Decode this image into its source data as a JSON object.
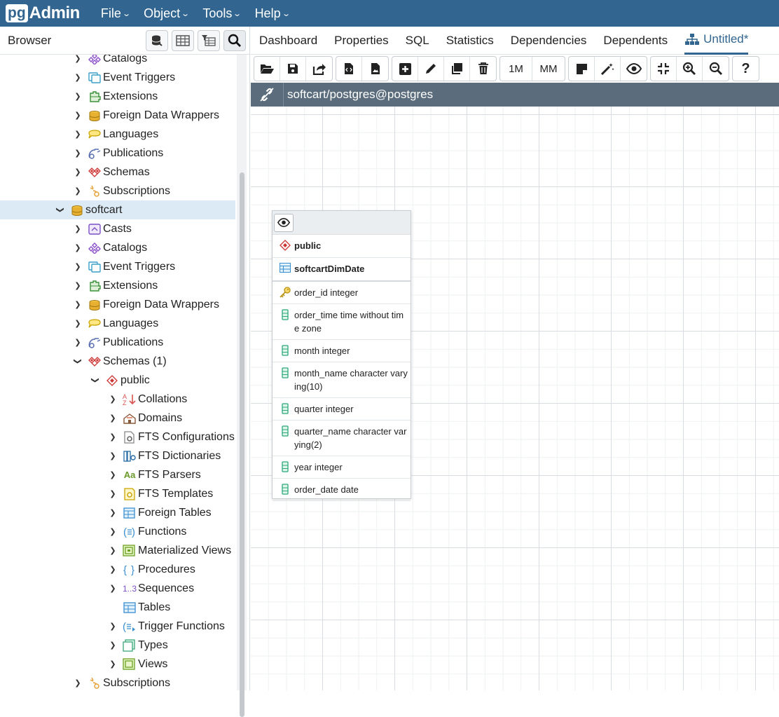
{
  "app": {
    "logo_pg": "pg",
    "logo_admin": "Admin"
  },
  "menu": [
    {
      "label": "File"
    },
    {
      "label": "Object"
    },
    {
      "label": "Tools"
    },
    {
      "label": "Help"
    }
  ],
  "browser": {
    "title": "Browser",
    "tree": [
      {
        "label": "Catalogs",
        "icon": "catalog-icon",
        "chevron": "right"
      },
      {
        "label": "Event Triggers",
        "icon": "event-trigger-icon",
        "chevron": "right"
      },
      {
        "label": "Extensions",
        "icon": "extension-icon",
        "chevron": "right"
      },
      {
        "label": "Foreign Data Wrappers",
        "icon": "fdw-icon",
        "chevron": "right"
      },
      {
        "label": "Languages",
        "icon": "language-icon",
        "chevron": "right"
      },
      {
        "label": "Publications",
        "icon": "publication-icon",
        "chevron": "right"
      },
      {
        "label": "Schemas",
        "icon": "schemas-icon",
        "chevron": "right"
      },
      {
        "label": "Subscriptions",
        "icon": "subscription-icon",
        "chevron": "right"
      },
      {
        "label": "softcart",
        "icon": "database-icon",
        "chevron": "down",
        "selected": true
      },
      {
        "label": "Casts",
        "icon": "cast-icon",
        "chevron": "right"
      },
      {
        "label": "Catalogs",
        "icon": "catalog-icon",
        "chevron": "right"
      },
      {
        "label": "Event Triggers",
        "icon": "event-trigger-icon",
        "chevron": "right"
      },
      {
        "label": "Extensions",
        "icon": "extension-icon",
        "chevron": "right"
      },
      {
        "label": "Foreign Data Wrappers",
        "icon": "fdw-icon",
        "chevron": "right"
      },
      {
        "label": "Languages",
        "icon": "language-icon",
        "chevron": "right"
      },
      {
        "label": "Publications",
        "icon": "publication-icon",
        "chevron": "right"
      },
      {
        "label": "Schemas (1)",
        "icon": "schemas-icon",
        "chevron": "down"
      },
      {
        "label": "public",
        "icon": "schema-icon",
        "chevron": "down"
      },
      {
        "label": "Collations",
        "icon": "collation-icon",
        "chevron": "right"
      },
      {
        "label": "Domains",
        "icon": "domain-icon",
        "chevron": "right"
      },
      {
        "label": "FTS Configurations",
        "icon": "fts-config-icon",
        "chevron": "right"
      },
      {
        "label": "FTS Dictionaries",
        "icon": "fts-dictionary-icon",
        "chevron": "right"
      },
      {
        "label": "FTS Parsers",
        "icon": "fts-parser-icon",
        "chevron": "right"
      },
      {
        "label": "FTS Templates",
        "icon": "fts-template-icon",
        "chevron": "right"
      },
      {
        "label": "Foreign Tables",
        "icon": "foreign-table-icon",
        "chevron": "right"
      },
      {
        "label": "Functions",
        "icon": "function-icon",
        "chevron": "right"
      },
      {
        "label": "Materialized Views",
        "icon": "materialized-view-icon",
        "chevron": "right"
      },
      {
        "label": "Procedures",
        "icon": "procedure-icon",
        "chevron": "right"
      },
      {
        "label": "Sequences",
        "icon": "sequence-icon",
        "chevron": "right"
      },
      {
        "label": "Tables",
        "icon": "table-icon",
        "chevron": "none"
      },
      {
        "label": "Trigger Functions",
        "icon": "trigger-function-icon",
        "chevron": "right"
      },
      {
        "label": "Types",
        "icon": "type-icon",
        "chevron": "right"
      },
      {
        "label": "Views",
        "icon": "view-icon",
        "chevron": "right"
      },
      {
        "label": "Subscriptions",
        "icon": "subscription-icon",
        "chevron": "right"
      }
    ],
    "sequence_glyph": "1..3",
    "fts_parser_glyph": "Aa"
  },
  "tabs": [
    {
      "label": "Dashboard"
    },
    {
      "label": "Properties"
    },
    {
      "label": "SQL"
    },
    {
      "label": "Statistics"
    },
    {
      "label": "Dependencies"
    },
    {
      "label": "Dependents"
    },
    {
      "label": "Untitled*",
      "active": true
    }
  ],
  "toolbar": {
    "one_to_many": "1M",
    "many_to_many": "MM",
    "help": "?"
  },
  "connection": {
    "label": "softcart/postgres@postgres"
  },
  "erd_table": {
    "schema": "public",
    "name": "softcartDimDate",
    "columns": [
      {
        "label": "order_id integer",
        "key": true
      },
      {
        "label": "order_time time without time zone",
        "key": false
      },
      {
        "label": "month integer",
        "key": false
      },
      {
        "label": "month_name character varying(10)",
        "key": false
      },
      {
        "label": "quarter integer",
        "key": false
      },
      {
        "label": "quarter_name character varying(2)",
        "key": false
      },
      {
        "label": "year integer",
        "key": false
      },
      {
        "label": "order_date date",
        "key": false
      }
    ]
  },
  "colors": {
    "brand": "#326690",
    "connection_bar": "#5b6d7c",
    "selection": "#dbeaf5"
  }
}
